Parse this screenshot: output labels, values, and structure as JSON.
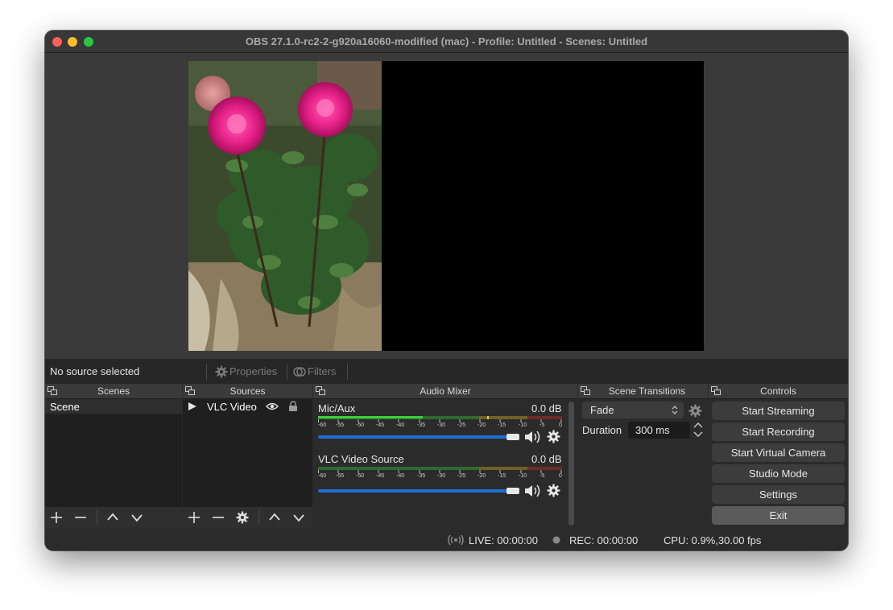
{
  "window": {
    "title": "OBS 27.1.0-rc2-2-g920a16060-modified (mac) - Profile: Untitled - Scenes: Untitled"
  },
  "source_toolbar": {
    "status": "No source selected",
    "properties_label": "Properties",
    "filters_label": "Filters"
  },
  "docks": {
    "scenes": {
      "title": "Scenes",
      "items": [
        "Scene"
      ]
    },
    "sources": {
      "title": "Sources",
      "items": [
        {
          "name": "VLC Video"
        }
      ]
    },
    "audio_mixer": {
      "title": "Audio Mixer",
      "channels": [
        {
          "name": "Mic/Aux",
          "db": "0.0 dB",
          "volume": 1.0
        },
        {
          "name": "VLC Video Source",
          "db": "0.0 dB",
          "volume": 1.0
        }
      ],
      "scale": [
        "-60",
        "-55",
        "-50",
        "-45",
        "-40",
        "-35",
        "-30",
        "-25",
        "-20",
        "-15",
        "-10",
        "-5",
        "0"
      ]
    },
    "scene_transitions": {
      "title": "Scene Transitions",
      "transition": "Fade",
      "duration_label": "Duration",
      "duration_value": "300 ms"
    },
    "controls": {
      "title": "Controls",
      "buttons": [
        "Start Streaming",
        "Start Recording",
        "Start Virtual Camera",
        "Studio Mode",
        "Settings",
        "Exit"
      ]
    }
  },
  "status_bar": {
    "live": "LIVE: 00:00:00",
    "rec": "REC: 00:00:00",
    "cpu": "CPU: 0.9%,30.00 fps"
  },
  "colors": {
    "window_bg": "#2b2b2b",
    "accent_slider": "#1f6fd6",
    "meter_green": "#3ccf3c",
    "meter_yellow": "#c9b52b",
    "meter_red": "#c93b3b"
  }
}
